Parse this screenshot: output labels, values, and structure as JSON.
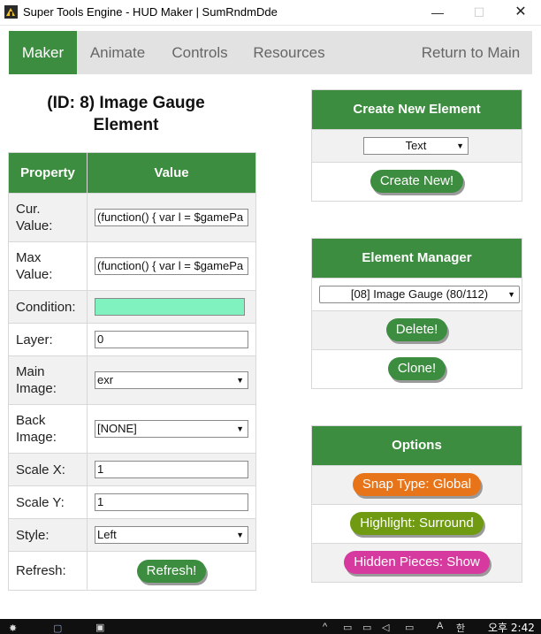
{
  "window": {
    "title": "Super Tools Engine  -  HUD Maker  |  SumRndmDde",
    "minimize": "—",
    "maximize": "☐",
    "close": "✕"
  },
  "nav": {
    "tabs": [
      "Maker",
      "Animate",
      "Controls",
      "Resources"
    ],
    "return_label": "Return to Main"
  },
  "element": {
    "title_line1": "(ID: 8) Image Gauge",
    "title_line2": "Element"
  },
  "props_table": {
    "header_property": "Property",
    "header_value": "Value",
    "cur_value_label": "Cur. Value:",
    "cur_value": "(function() { var l = $gamePa",
    "max_value_label": "Max Value:",
    "max_value": "(function() { var l = $gamePa",
    "condition_label": "Condition:",
    "condition_value": "",
    "layer_label": "Layer:",
    "layer_value": "0",
    "main_image_label": "Main Image:",
    "main_image_value": "exr",
    "back_image_label": "Back Image:",
    "back_image_value": "[NONE]",
    "scale_x_label": "Scale X:",
    "scale_x_value": "1",
    "scale_y_label": "Scale Y:",
    "scale_y_value": "1",
    "style_label": "Style:",
    "style_value": "Left",
    "refresh_label": "Refresh:",
    "refresh_button": "Refresh!"
  },
  "create_panel": {
    "title": "Create New Element",
    "type_value": "Text",
    "create_button": "Create New!"
  },
  "manager_panel": {
    "title": "Element Manager",
    "selected": "[08] Image Gauge (80/112)",
    "delete_button": "Delete!",
    "clone_button": "Clone!"
  },
  "options_panel": {
    "title": "Options",
    "snap_label": "Snap Type: Global",
    "highlight_label": "Highlight: Surround",
    "hidden_label": "Hidden Pieces: Show",
    "colors": {
      "snap": "#e8741a",
      "highlight": "#6f9a12",
      "hidden": "#d63a9e",
      "accent": "#3c8d3f"
    }
  },
  "taskbar": {
    "clock": "오후 2:42",
    "ime": "A",
    "lang": "한"
  }
}
